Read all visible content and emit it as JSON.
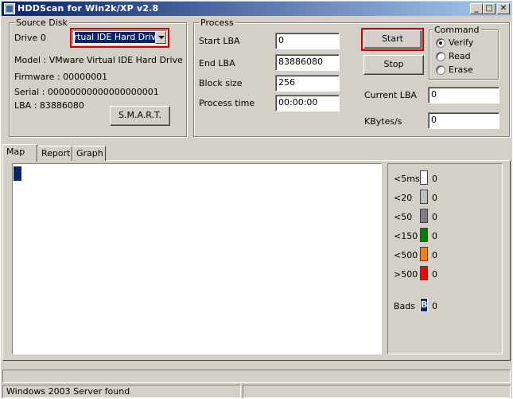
{
  "window": {
    "title": "HDDScan for Win2k/XP  v2.8",
    "minimize_glyph": "_",
    "maximize_glyph": "□",
    "close_glyph": "✕"
  },
  "source_disk": {
    "group_title": "Source Disk",
    "drive_label": "Drive  0",
    "drive_selected": "Virtual IDE Hard Drive",
    "model": "Model : VMware Virtual IDE Hard Drive",
    "firmware": "Firmware : 00000001",
    "serial": "Serial : 00000000000000000001",
    "lba": "LBA :  83886080",
    "smart_button": "S.M.A.R.T."
  },
  "process": {
    "group_title": "Process",
    "start_lba_label": "Start LBA",
    "start_lba_value": "0",
    "end_lba_label": "End LBA",
    "end_lba_value": "83886080",
    "block_size_label": "Block size",
    "block_size_value": "256",
    "process_time_label": "Process time",
    "process_time_value": "00:00:00",
    "start_button": "Start",
    "stop_button": "Stop",
    "current_lba_label": "Current LBA",
    "current_lba_value": "0",
    "kbytes_label": "KBytes/s",
    "kbytes_value": "0"
  },
  "command": {
    "group_title": "Command",
    "options": [
      "Verify",
      "Read",
      "Erase"
    ],
    "selected": "Verify"
  },
  "tabs": [
    "Map",
    "Report",
    "Graph"
  ],
  "active_tab": "Map",
  "legend": [
    {
      "label": "<5ms",
      "count": "0",
      "color": "#ffffff"
    },
    {
      "label": "<20",
      "count": "0",
      "color": "#c0c0c0"
    },
    {
      "label": "<50",
      "count": "0",
      "color": "#808080"
    },
    {
      "label": "<150",
      "count": "0",
      "color": "#008000"
    },
    {
      "label": "<500",
      "count": "0",
      "color": "#ff8000"
    },
    {
      "label": ">500",
      "count": "0",
      "color": "#ff0000"
    }
  ],
  "bads": {
    "label": "Bads",
    "count": "0",
    "swatch_letter": "B",
    "color": "#0a246a"
  },
  "status": {
    "message": "Windows 2003 Server found"
  }
}
